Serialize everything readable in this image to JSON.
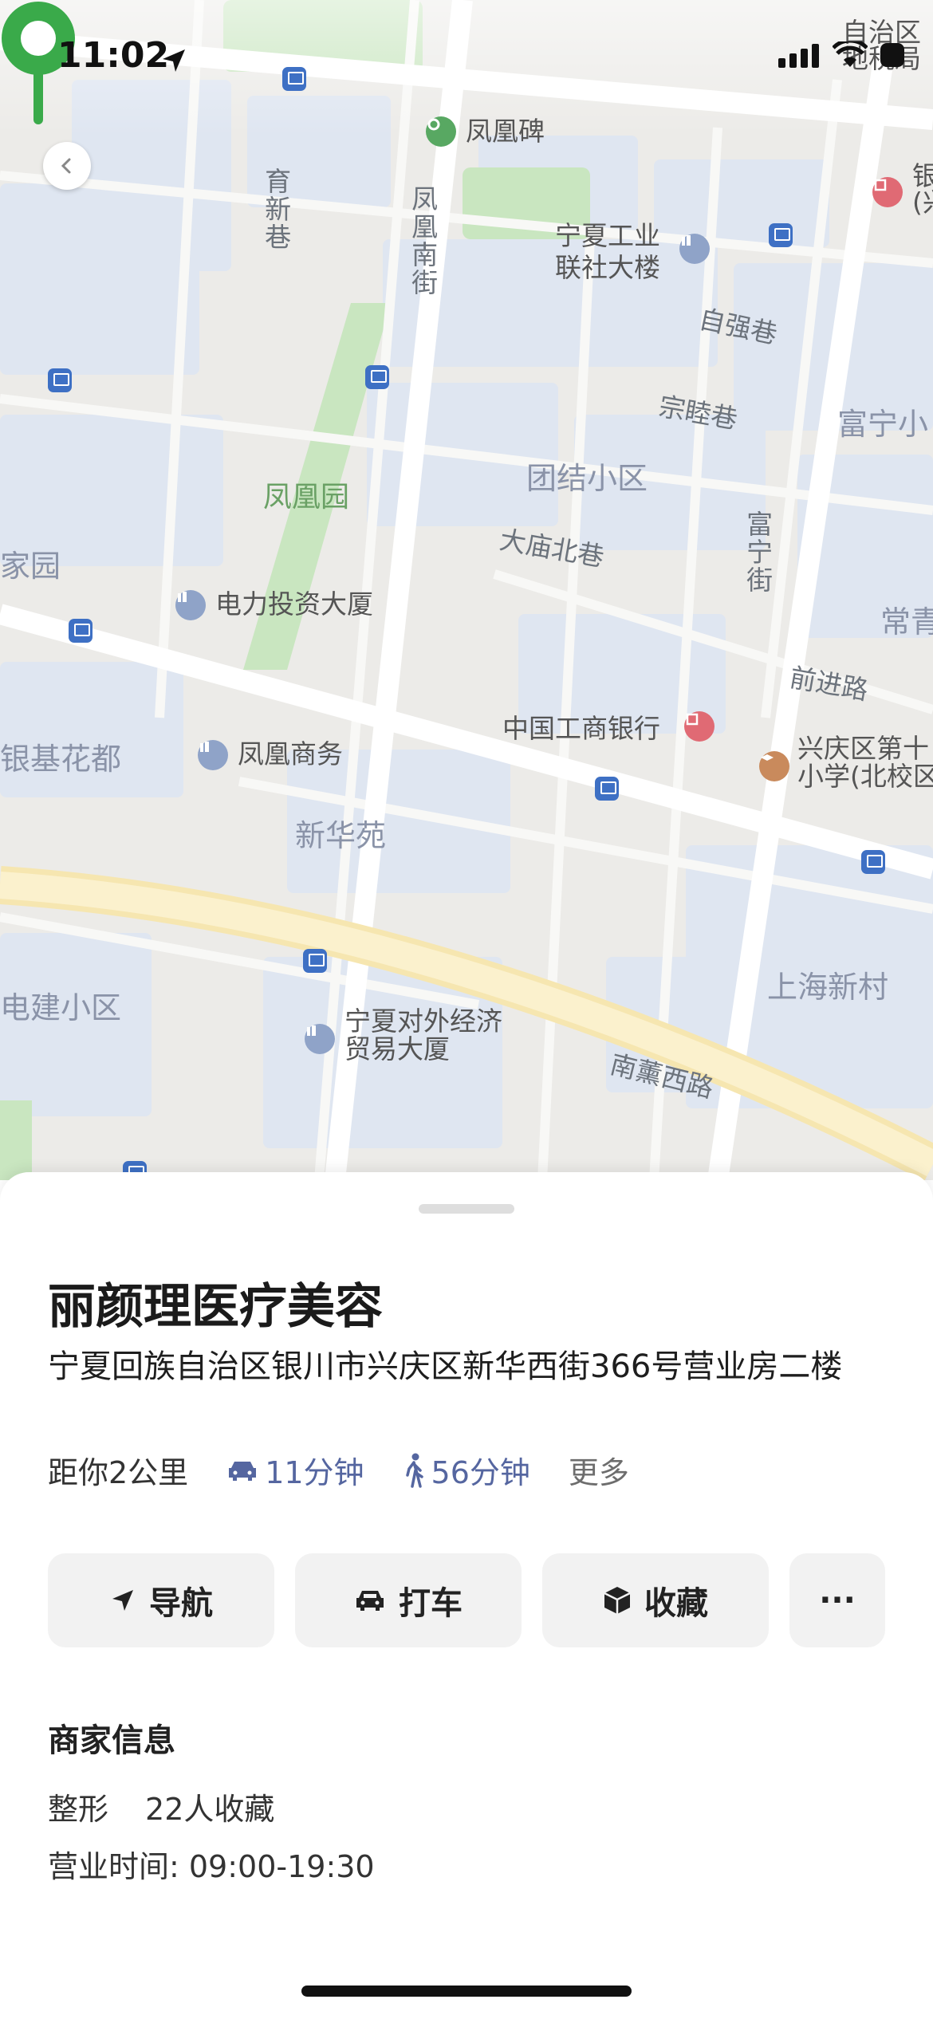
{
  "status_bar": {
    "time": "11:02",
    "icons": [
      "location-arrow-icon",
      "cellular-signal-icon",
      "wifi-icon",
      "battery-icon"
    ]
  },
  "map": {
    "labels": {
      "fenghuangbei": "凤凰碑",
      "yuxinxiang": "育新巷",
      "fenghuang_nanjie": "凤凰南街",
      "ningxia_gongye": "宁夏工业\n联社大楼",
      "ziqiangxiang": "自强巷",
      "zongmuxiang": "宗睦巷",
      "funing_xiao": "富宁小",
      "tuanjie": "团结小区",
      "fenghuangyuan": "凤凰园",
      "damiao": "大庙北巷",
      "funingjie": "富宁街",
      "jiayuan": "家园",
      "dianli": "电力投资大厦",
      "changqing": "常青",
      "qianjinlu": "前进路",
      "icbc": "中国工商银行",
      "xingqing_school": "兴庆区第十\n小学(北校区",
      "yinji": "银基花都",
      "fenghuang_shangwu": "凤凰商务",
      "xinhuayuan": "新华苑",
      "shanghai": "上海新村",
      "dianjian": "电建小区",
      "ningxia_duiwai": "宁夏对外经济\n贸易大厦",
      "nanxunxilu": "南薰西路",
      "tax": "自治区\n地税局",
      "bank_top": "银\n(兴"
    }
  },
  "place": {
    "name": "丽颜理医疗美容",
    "address": "宁夏回族自治区银川市兴庆区新华西街366号营业房二楼",
    "distance": "距你2公里",
    "drive_time": "11分钟",
    "walk_time": "56分钟",
    "more": "更多"
  },
  "actions": {
    "navigate": "导航",
    "taxi": "打车",
    "favorite": "收藏",
    "more": "···"
  },
  "merchant": {
    "title": "商家信息",
    "category": "整形",
    "favorites": "22人收藏",
    "hours": "营业时间: 09:00-19:30"
  },
  "colors": {
    "accent_green": "#3aaa4a",
    "link_blue": "#5566a0",
    "button_bg": "#f2f2f2"
  }
}
